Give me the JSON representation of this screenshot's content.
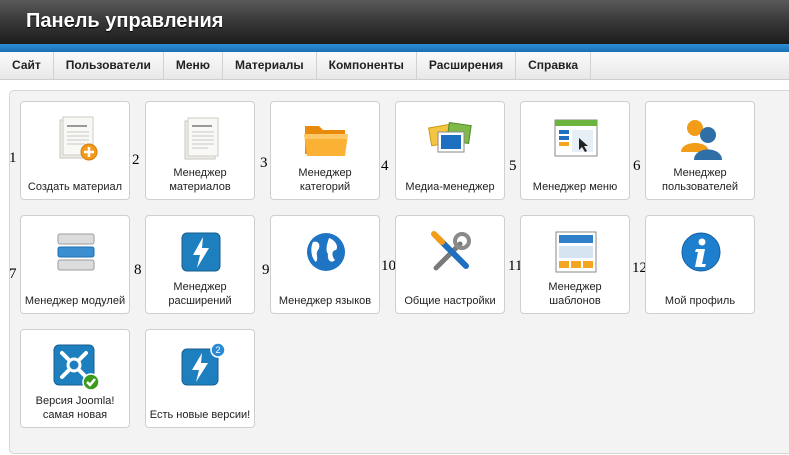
{
  "header": {
    "title": "Панель управления"
  },
  "menu": [
    "Сайт",
    "Пользователи",
    "Меню",
    "Материалы",
    "Компоненты",
    "Расширения",
    "Справка"
  ],
  "tiles": [
    {
      "num": "1",
      "label": "Создать материал",
      "icon": "add-article-icon"
    },
    {
      "num": "2",
      "label": "Менеджер материалов",
      "icon": "article-manager-icon"
    },
    {
      "num": "3",
      "label": "Менеджер категорий",
      "icon": "folder-icon"
    },
    {
      "num": "4",
      "label": "Медиа-менеджер",
      "icon": "media-icon"
    },
    {
      "num": "5",
      "label": "Менеджер меню",
      "icon": "menu-window-icon"
    },
    {
      "num": "6",
      "label": "Менеджер пользователей",
      "icon": "users-icon"
    },
    {
      "num": "7",
      "label": "Менеджер модулей",
      "icon": "modules-icon"
    },
    {
      "num": "8",
      "label": "Менеджер расширений",
      "icon": "lightning-icon"
    },
    {
      "num": "9",
      "label": "Менеджер языков",
      "icon": "globe-icon"
    },
    {
      "num": "10",
      "label": "Общие настройки",
      "icon": "tools-icon"
    },
    {
      "num": "11",
      "label": "Менеджер шаблонов",
      "icon": "template-icon"
    },
    {
      "num": "12",
      "label": "Мой профиль",
      "icon": "info-icon"
    },
    {
      "num": "",
      "label": "Версия Joomla! самая новая",
      "icon": "joomla-check-icon"
    },
    {
      "num": "",
      "label": "Есть новые версии!",
      "icon": "update-available-icon"
    }
  ],
  "update_badge": "2",
  "colors": {
    "header": "#2a2a2a",
    "accent_blue": "#1a78c2",
    "folder": "#f7a21b",
    "check_green": "#3c9a1c"
  }
}
